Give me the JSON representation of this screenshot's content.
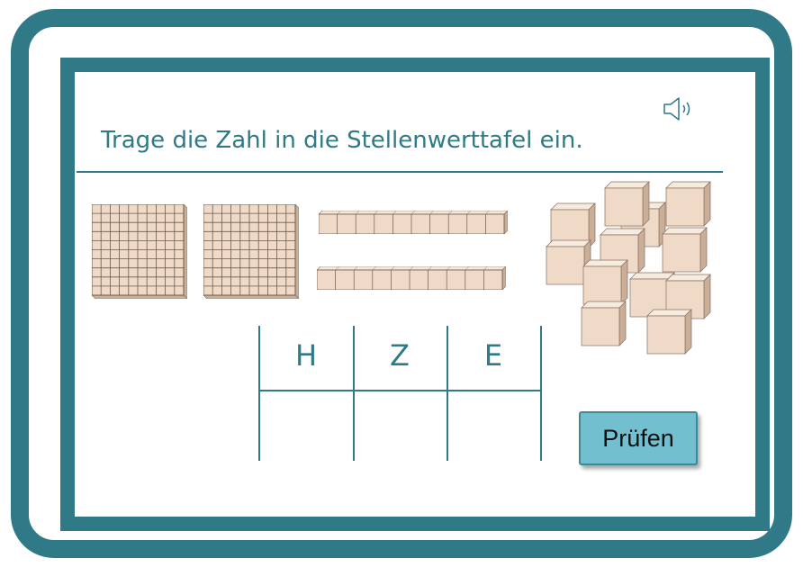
{
  "task": {
    "title": "Trage die Zahl in die Stellenwerttafel ein."
  },
  "audio": {
    "icon": "speaker-icon"
  },
  "blocks": {
    "hundreds": 2,
    "tens": 2,
    "ones": 11
  },
  "place_value_table": {
    "headers": [
      "H",
      "Z",
      "E"
    ],
    "values": [
      "",
      "",
      ""
    ]
  },
  "check_button": {
    "label": "Prüfen"
  },
  "colors": {
    "frame": "#2f7a86",
    "block_fill": "#efdac8",
    "block_side": "#c9ae98",
    "button": "#72bfcf"
  }
}
